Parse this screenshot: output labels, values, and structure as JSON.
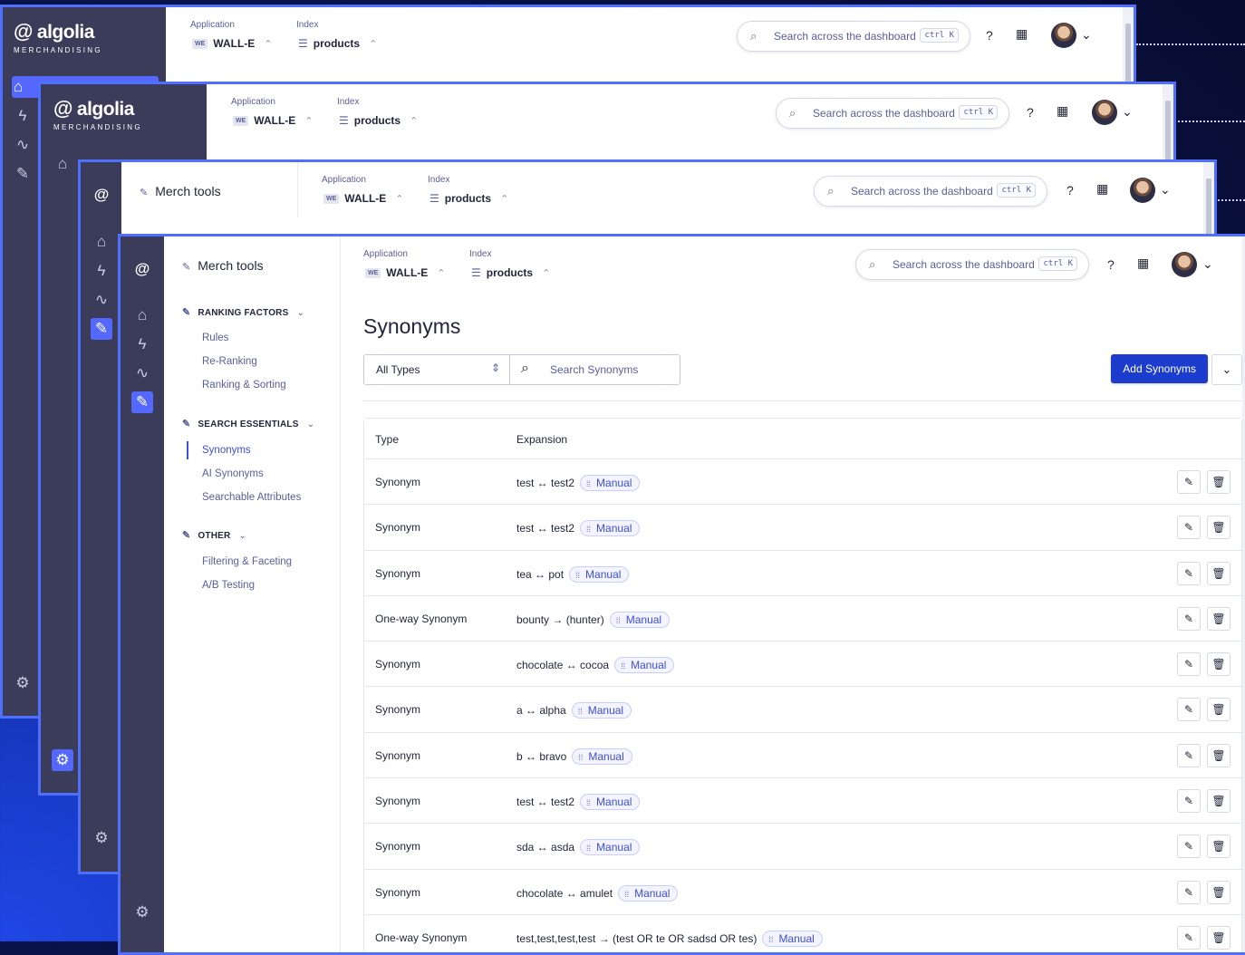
{
  "brand": {
    "logo_mark": "@",
    "name": "algolia",
    "sub": "MERCHANDISING"
  },
  "topbar": {
    "application_label": "Application",
    "application_value": "WALL-E",
    "application_badge": "WE",
    "index_label": "Index",
    "index_value": "products",
    "search_placeholder": "Search across the dashboard",
    "shortcut": "ctrl K"
  },
  "submenu": {
    "title": "Merch tools",
    "sections": [
      {
        "label": "RANKING FACTORS",
        "items": [
          "Rules",
          "Re-Ranking",
          "Ranking & Sorting"
        ]
      },
      {
        "label": "SEARCH ESSENTIALS",
        "items": [
          "Synonyms",
          "AI Synonyms",
          "Searchable Attributes"
        ]
      },
      {
        "label": "OTHER",
        "items": [
          "Filtering & Faceting",
          "A/B Testing"
        ]
      }
    ],
    "active_item": "Synonyms"
  },
  "page": {
    "title": "Synonyms",
    "type_filter": "All Types",
    "search_placeholder": "Search Synonyms",
    "add_button": "Add Synonyms"
  },
  "table": {
    "columns": [
      "Type",
      "Expansion"
    ],
    "rows": [
      {
        "type": "Synonym",
        "expansion": "test ↔ test2",
        "source": "Manual"
      },
      {
        "type": "Synonym",
        "expansion": "test ↔ test2",
        "source": "Manual"
      },
      {
        "type": "Synonym",
        "expansion": "tea ↔ pot",
        "source": "Manual"
      },
      {
        "type": "One-way Synonym",
        "expansion": "bounty → (hunter)",
        "source": "Manual"
      },
      {
        "type": "Synonym",
        "expansion": "chocolate ↔ cocoa",
        "source": "Manual"
      },
      {
        "type": "Synonym",
        "expansion": "a ↔ alpha",
        "source": "Manual"
      },
      {
        "type": "Synonym",
        "expansion": "b ↔ bravo",
        "source": "Manual"
      },
      {
        "type": "Synonym",
        "expansion": "test ↔ test2",
        "source": "Manual"
      },
      {
        "type": "Synonym",
        "expansion": "sda ↔ asda",
        "source": "Manual"
      },
      {
        "type": "Synonym",
        "expansion": "chocolate ↔ amulet",
        "source": "Manual"
      },
      {
        "type": "One-way Synonym",
        "expansion": "test,test,test,test → (test OR te OR sadsd OR tes)",
        "source": "Manual"
      }
    ]
  },
  "icons": {
    "home": "home-icon",
    "bolt": "bolt-icon",
    "pulse": "pulse-icon",
    "wrench": "wrench-icon",
    "settings": "gear-icon",
    "edit": "edit-icon",
    "delete": "trash-icon"
  },
  "colors": {
    "accent": "#5468ff",
    "primary_button": "#1c3ccd",
    "rail": "#3a3c5a",
    "frame": "#4f6fff"
  }
}
